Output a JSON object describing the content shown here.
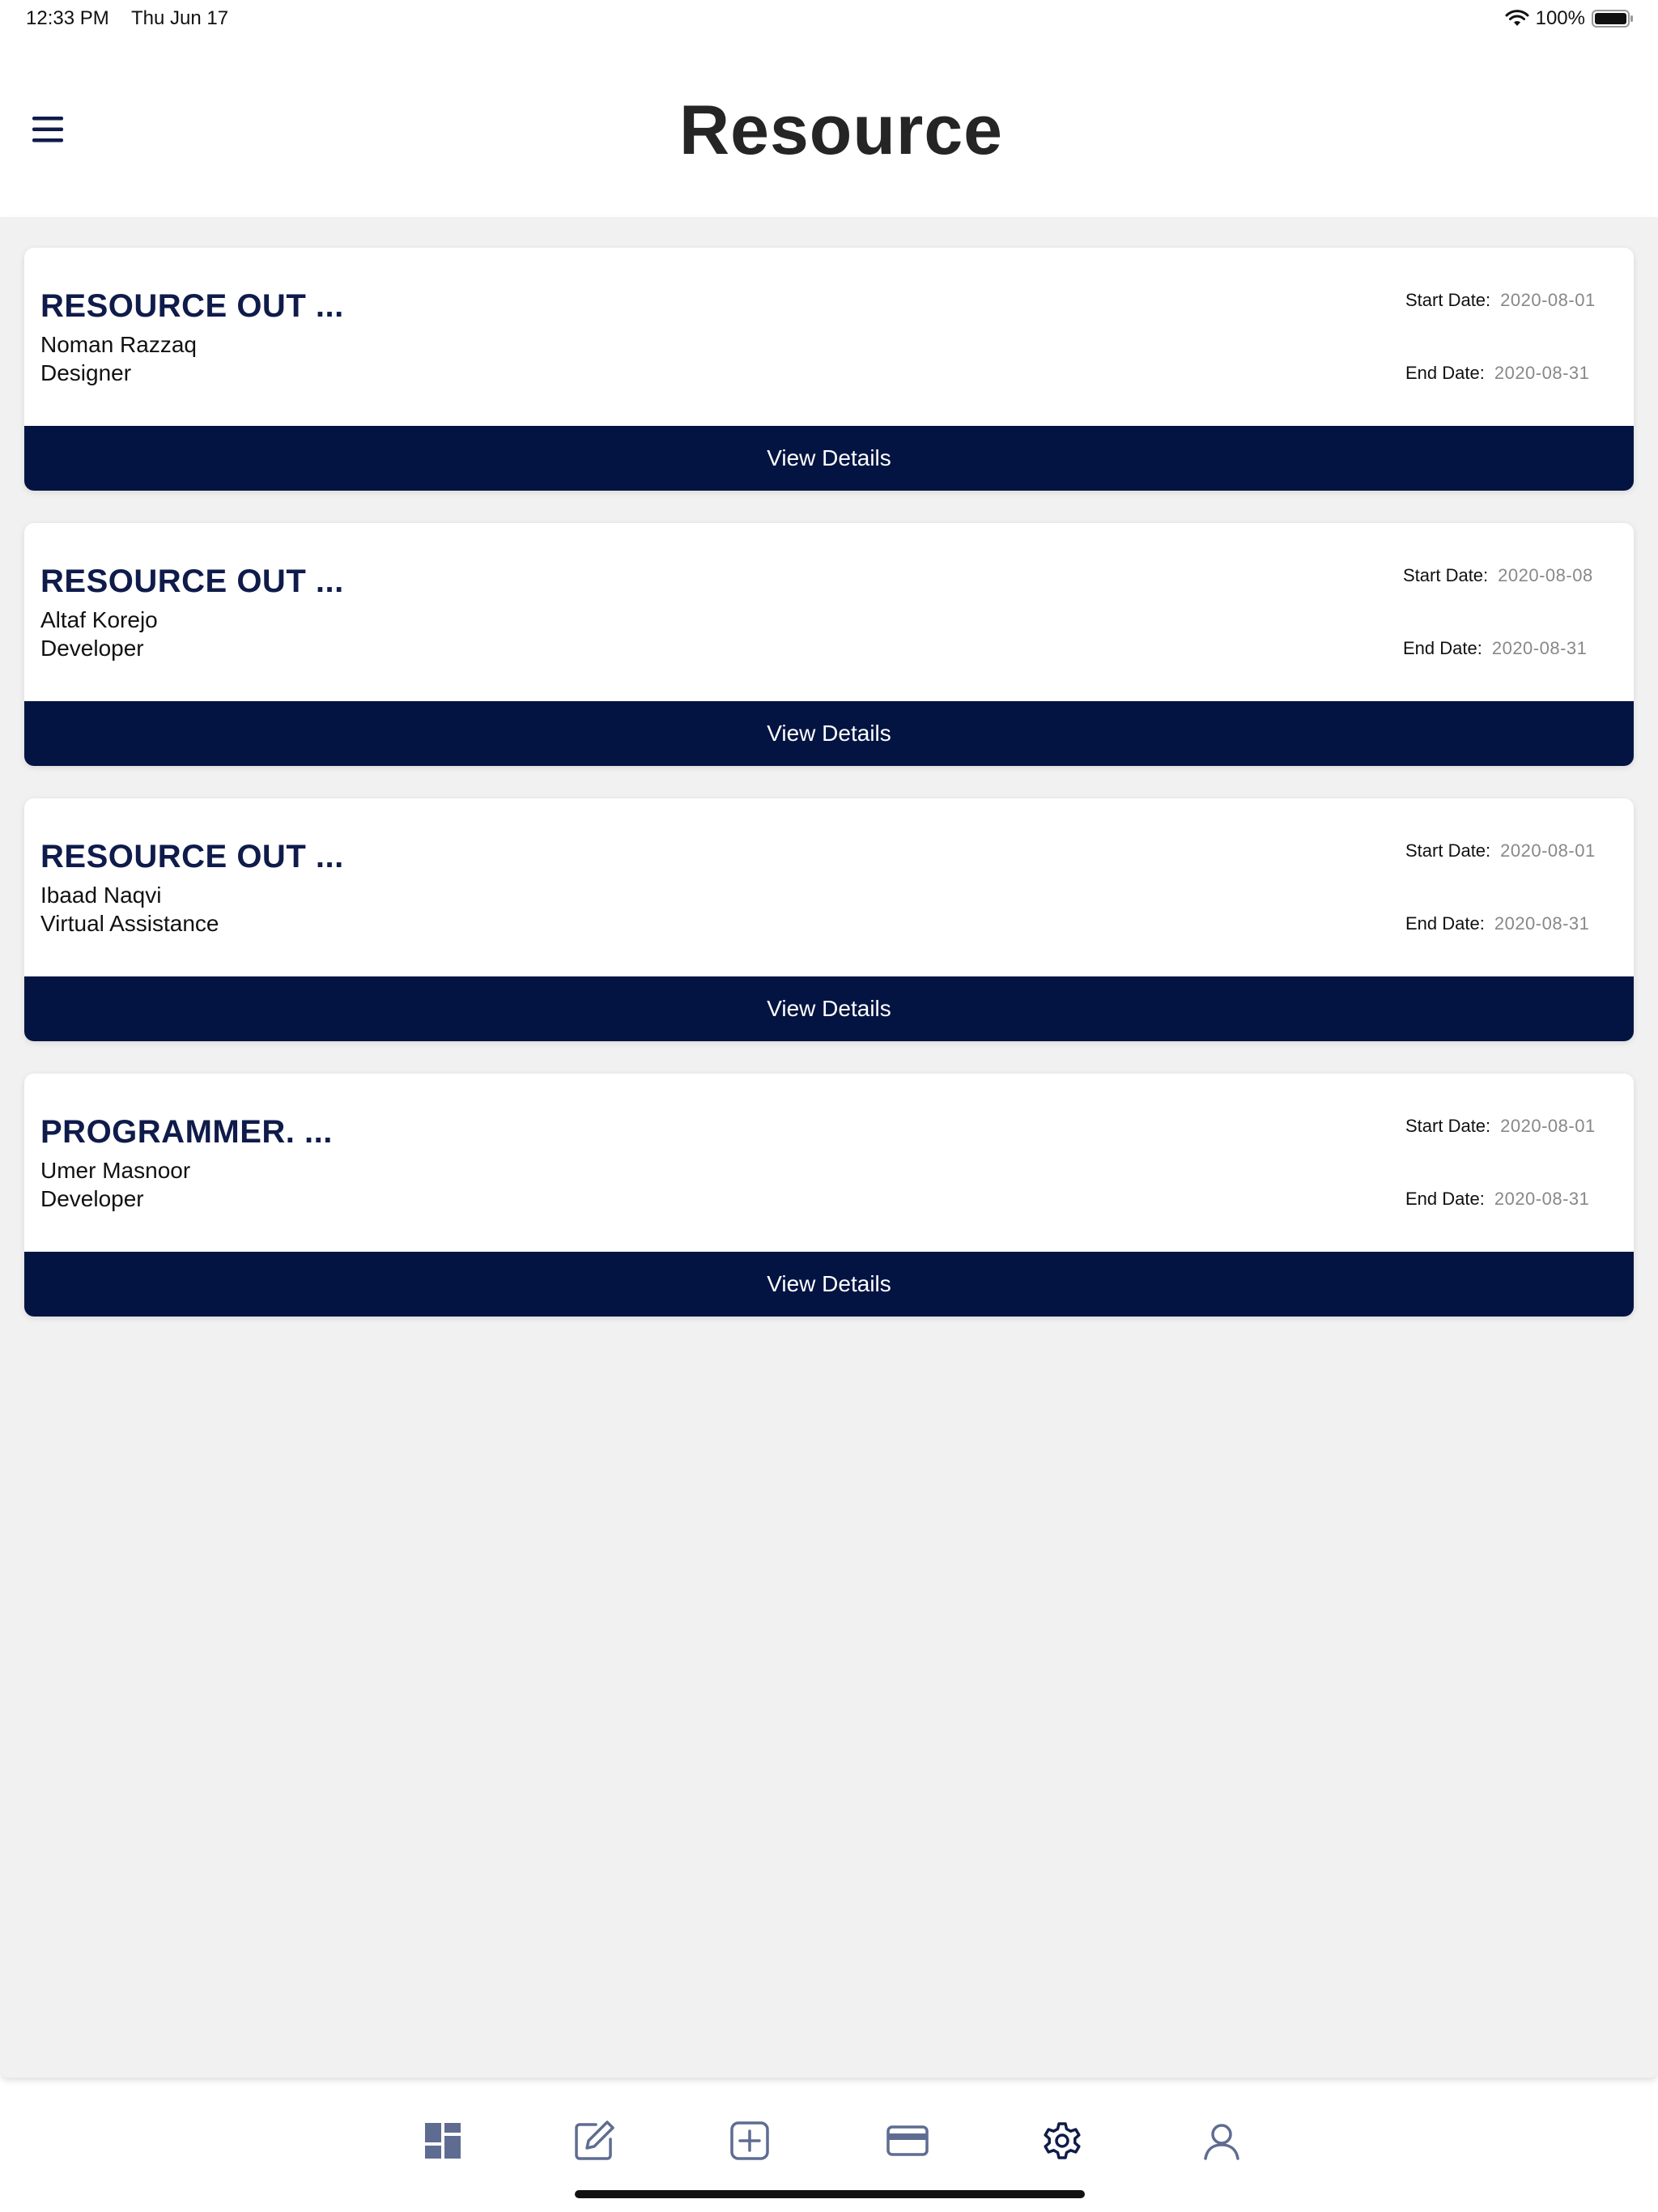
{
  "status_bar": {
    "time": "12:33 PM",
    "date": "Thu Jun 17",
    "battery": "100%"
  },
  "header": {
    "title": "Resource"
  },
  "labels": {
    "start_date": "Start Date:",
    "end_date": "End Date:"
  },
  "cards": [
    {
      "title": "RESOURCE OUT ...",
      "name": "Noman Razzaq",
      "role": "Designer",
      "start_date": "2020-08-01",
      "end_date": "2020-08-31",
      "button": "View Details"
    },
    {
      "title": "RESOURCE OUT ...",
      "name": "Altaf Korejo",
      "role": "Developer",
      "start_date": "2020-08-08",
      "end_date": "2020-08-31",
      "button": "View Details"
    },
    {
      "title": "RESOURCE OUT ...",
      "name": "Ibaad Naqvi",
      "role": "Virtual Assistance",
      "start_date": "2020-08-01",
      "end_date": "2020-08-31",
      "button": "View Details"
    },
    {
      "title": "PROGRAMMER.  ...",
      "name": "Umer Masnoor",
      "role": "Developer",
      "start_date": "2020-08-01",
      "end_date": "2020-08-31",
      "button": "View Details"
    }
  ],
  "tab_bar": {
    "items": [
      {
        "icon": "dashboard-icon",
        "active": false
      },
      {
        "icon": "edit-icon",
        "active": false
      },
      {
        "icon": "add-square-icon",
        "active": false
      },
      {
        "icon": "credit-card-icon",
        "active": false
      },
      {
        "icon": "settings-icon",
        "active": true
      },
      {
        "icon": "user-icon",
        "active": false
      }
    ]
  },
  "colors": {
    "primary": "#031442",
    "inactive_icon": "#5f6c92",
    "active_icon": "#0f1b4a",
    "background": "#f1f1f1"
  }
}
